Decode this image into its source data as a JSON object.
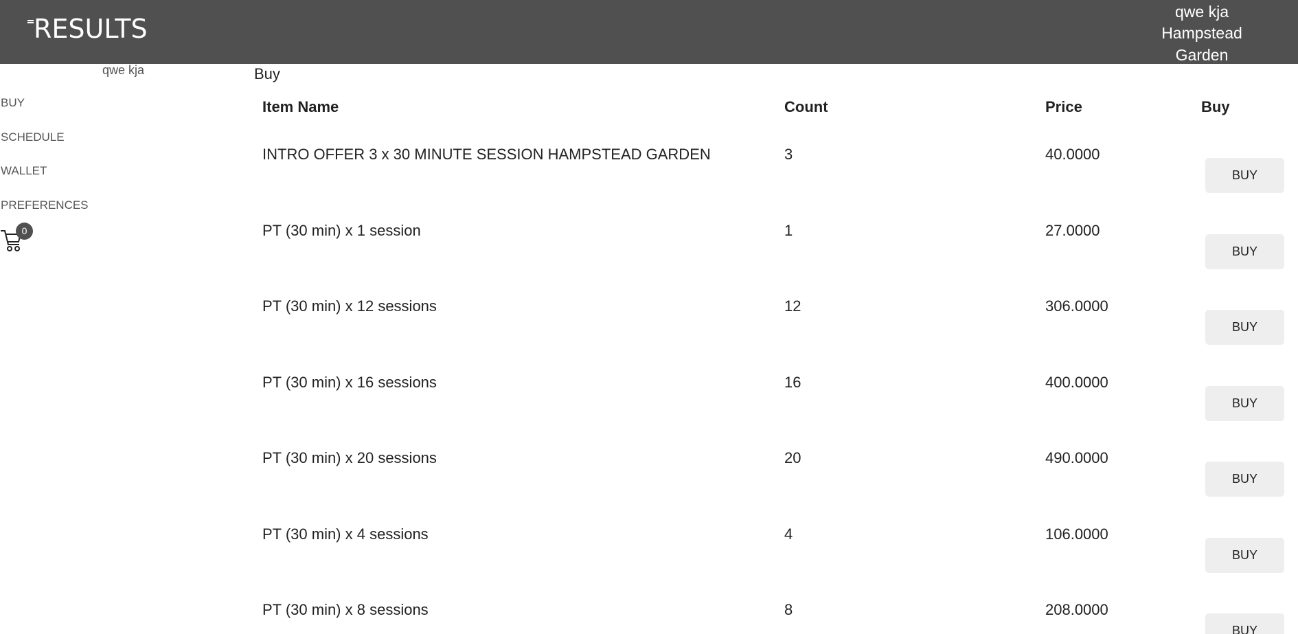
{
  "header": {
    "logo_text": "RESULTS",
    "user_name": "qwe kja",
    "location": "Hampstead Garden"
  },
  "sidebar": {
    "user_name": "qwe kja",
    "items": [
      {
        "label": "BUY"
      },
      {
        "label": "SCHEDULE"
      },
      {
        "label": "WALLET"
      },
      {
        "label": "PREFERENCES"
      }
    ],
    "cart_count": "0"
  },
  "main": {
    "title": "Buy",
    "columns": {
      "item_name": "Item Name",
      "count": "Count",
      "price": "Price",
      "buy": "Buy"
    },
    "rows": [
      {
        "name": "INTRO OFFER 3 x 30 MINUTE SESSION HAMPSTEAD GARDEN",
        "count": "3",
        "price": "40.0000",
        "button": "BUY"
      },
      {
        "name": "PT (30 min) x 1 session",
        "count": "1",
        "price": "27.0000",
        "button": "BUY"
      },
      {
        "name": "PT (30 min) x 12 sessions",
        "count": "12",
        "price": "306.0000",
        "button": "BUY"
      },
      {
        "name": "PT (30 min) x 16 sessions",
        "count": "16",
        "price": "400.0000",
        "button": "BUY"
      },
      {
        "name": "PT (30 min) x 20 sessions",
        "count": "20",
        "price": "490.0000",
        "button": "BUY"
      },
      {
        "name": "PT (30 min) x 4 sessions",
        "count": "4",
        "price": "106.0000",
        "button": "BUY"
      },
      {
        "name": "PT (30 min) x 8 sessions",
        "count": "8",
        "price": "208.0000",
        "button": "BUY"
      }
    ]
  }
}
